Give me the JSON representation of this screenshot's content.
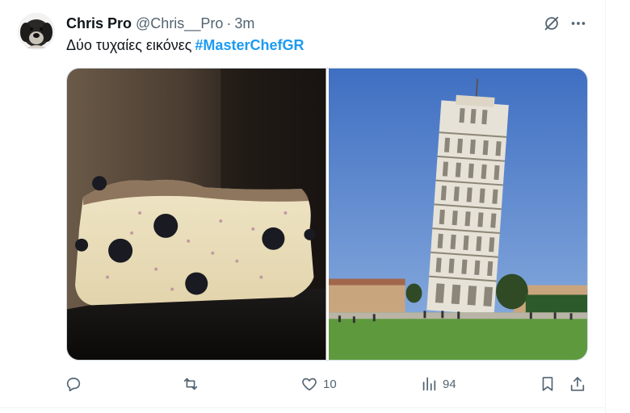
{
  "tweet": {
    "display_name": "Chris Pro",
    "handle": "@Chris__Pro",
    "separator": "·",
    "time": "3m",
    "text": "Δύο τυχαίες εικόνες",
    "hashtag": "#MasterChefGR"
  },
  "media": {
    "photos": [
      {
        "subject": "cake"
      },
      {
        "subject": "leaning-tower"
      }
    ]
  },
  "actions": {
    "likes": "10",
    "views": "94"
  },
  "icons": {
    "top_right": [
      "grok-icon",
      "more-icon"
    ],
    "bar": [
      "reply-icon",
      "retweet-icon",
      "like-icon",
      "views-icon",
      "bookmark-icon",
      "share-icon"
    ]
  },
  "colors": {
    "accent": "#1d9bf0",
    "secondary_text": "#536471",
    "primary_text": "#0f1419",
    "border": "#eff3f4"
  }
}
